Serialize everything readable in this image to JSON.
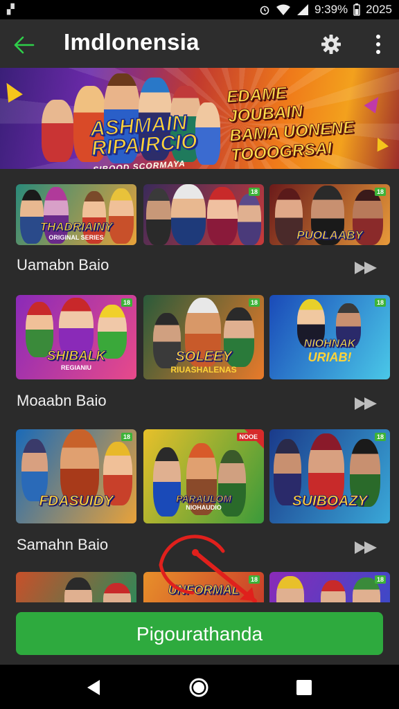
{
  "statusbar": {
    "time": "9:39%",
    "year": "2025",
    "app_icon": "notification-icon"
  },
  "toolbar": {
    "title": "Imdlonensia",
    "back_icon": "back-arrow-icon",
    "settings_icon": "gear-icon",
    "more_icon": "more-vert-icon"
  },
  "banner": {
    "logo_line1": "ASHMAIN",
    "logo_line2": "RIPAIRCIO",
    "logo_sub": "SIBOOD SCORMAYA",
    "promo_line1": "EDAME JOUBAIN",
    "promo_line2": "BAMA UONENE",
    "promo_line3": "TOOOGRSAI"
  },
  "sections": [
    {
      "label": "Uamabn Baio",
      "cards": [
        {
          "title": "THADRIAINY",
          "subtitle": "ORIGINAL SERIES",
          "badge": ""
        },
        {
          "title": "",
          "subtitle": "",
          "badge": "18"
        },
        {
          "title": "PUOLAABY",
          "subtitle": "",
          "badge": "18"
        }
      ]
    },
    {
      "label": "Moaabn Baio",
      "cards": [
        {
          "title": "SHIBALK",
          "subtitle": "REGIANIU",
          "badge": "18"
        },
        {
          "title": "SOLEEY",
          "subtitle": "RIUASHALENAS",
          "badge": "18"
        },
        {
          "title": "NIOHNAK",
          "subtitle": "URIAB!",
          "badge": "18"
        }
      ]
    },
    {
      "label": "Samahn Baio",
      "cards": [
        {
          "title": "FDASUIDY",
          "subtitle": "",
          "badge": "18"
        },
        {
          "title": "PARAULOM",
          "subtitle": "NIOHAUDIO",
          "badge": "NOOE"
        },
        {
          "title": "SUIBOAZY",
          "subtitle": "",
          "badge": "18"
        }
      ]
    },
    {
      "label": "",
      "cards": [
        {
          "title": "",
          "subtitle": "",
          "badge": ""
        },
        {
          "title": "UNFORMAL",
          "subtitle": "",
          "badge": "18"
        },
        {
          "title": "",
          "subtitle": "",
          "badge": "18"
        }
      ]
    }
  ],
  "cta": {
    "label": "Pigourathanda"
  },
  "navbar": {
    "back_icon": "nav-back-icon",
    "home_icon": "nav-home-icon",
    "recent_icon": "nav-recents-icon"
  },
  "colors": {
    "accent_green": "#2eaa3e",
    "background": "#2b2b2b",
    "annotation_red": "#e0201c"
  }
}
